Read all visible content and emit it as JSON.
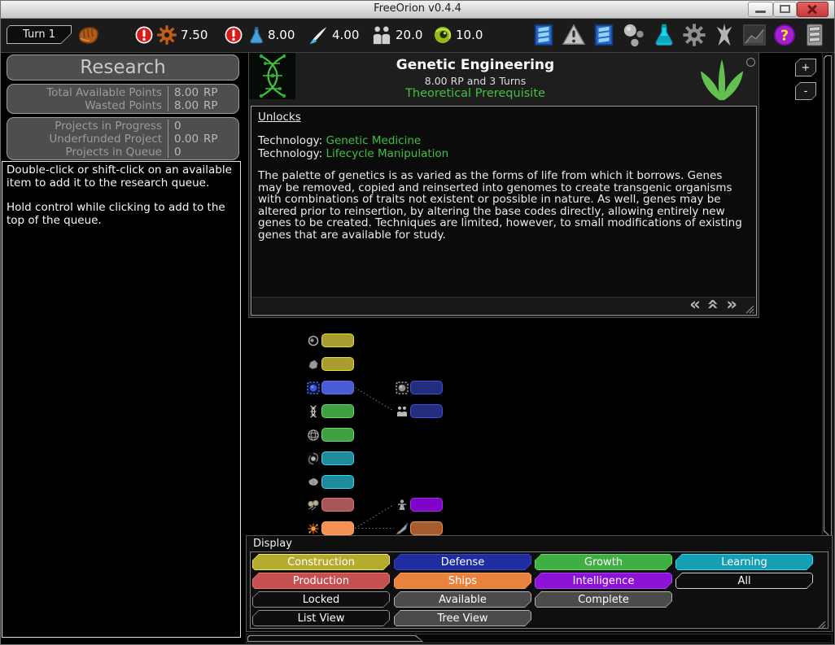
{
  "window": {
    "title": "FreeOrion v0.4.4"
  },
  "toolbar": {
    "turn_label": "Turn 1",
    "player_icon": "fist-icon",
    "resources": [
      {
        "name": "industry",
        "icon": "gearOrange",
        "alert": true,
        "value": "7.50"
      },
      {
        "name": "research",
        "icon": "flaskBlue",
        "alert": true,
        "value": "8.00"
      },
      {
        "name": "trade",
        "icon": "brush",
        "alert": false,
        "value": "4.00"
      },
      {
        "name": "population",
        "icon": "people",
        "alert": false,
        "value": "20.0"
      },
      {
        "name": "happiness",
        "icon": "eyeGreen",
        "alert": false,
        "value": "10.0"
      }
    ],
    "right_buttons": [
      {
        "name": "sitrep",
        "icon": "sitrep"
      },
      {
        "name": "alerts",
        "icon": "warning"
      },
      {
        "name": "queue",
        "icon": "sitrep"
      },
      {
        "name": "objects",
        "icon": "objects"
      },
      {
        "name": "research",
        "icon": "flaskCyan"
      },
      {
        "name": "production",
        "icon": "gearGray"
      },
      {
        "name": "design",
        "icon": "design"
      },
      {
        "name": "charts",
        "icon": "charts"
      },
      {
        "name": "pedia",
        "icon": "pedia"
      },
      {
        "name": "menu",
        "icon": "menu"
      }
    ]
  },
  "sidebar": {
    "title": "Research",
    "stats_points": [
      {
        "label": "Total Available Points",
        "value": "8.00",
        "unit": "RP"
      },
      {
        "label": "Wasted Points",
        "value": "8.00",
        "unit": "RP"
      }
    ],
    "stats_projects": [
      {
        "label": "Projects in Progress",
        "value": "0",
        "unit": ""
      },
      {
        "label": "Underfunded Project",
        "value": "0.00",
        "unit": "RP"
      },
      {
        "label": "Projects in Queue",
        "value": "0",
        "unit": ""
      }
    ],
    "help": [
      "Double-click or shift-click on an available item to add it to the research queue.",
      "Hold control while clicking to add to the top of the queue."
    ]
  },
  "detail": {
    "title": "Genetic Engineering",
    "cost": "8.00 RP and 3 Turns",
    "type": "Theoretical Prerequisite",
    "unlocks_heading": "Unlocks",
    "unlocks": [
      {
        "prefix": "Technology:",
        "name": "Genetic Medicine"
      },
      {
        "prefix": "Technology:",
        "name": "Lifecycle Manipulation"
      }
    ],
    "description": "The palette of genetics is as varied as the forms of life from which it borrows. Genes may be removed, copied and reinserted into genomes to create transgenic organisms with combinations of traits not existent or possible in nature. As well, genes may be altered prior to reinsertion, by altering the base codes directly, allowing entirely new genes to be created. Techniques are limited, however, to small modifications of existing genes that are available for study.",
    "nav": {
      "back": "«",
      "up": "«",
      "forward": "»"
    },
    "accent_green": "#3fc13f"
  },
  "zoom": {
    "in": "+",
    "out": "-"
  },
  "tree": {
    "nodes": [
      {
        "row": 0,
        "col": 0,
        "icon": "ring",
        "category": "construction",
        "fill": "#a79e2f",
        "border": "#e6df3e"
      },
      {
        "row": 1,
        "col": 0,
        "icon": "rock",
        "category": "construction",
        "fill": "#a79e2f",
        "border": "#e6df3e"
      },
      {
        "row": 2,
        "col": 0,
        "icon": "shieldBlue",
        "category": "defense",
        "fill": "#4a5cd6",
        "border": "#6170e8",
        "state": "selected"
      },
      {
        "row": 3,
        "col": 0,
        "icon": "dna",
        "category": "growth",
        "fill": "#3f9f43",
        "border": "#62df66"
      },
      {
        "row": 4,
        "col": 0,
        "icon": "globe",
        "category": "growth",
        "fill": "#3f9f43",
        "border": "#62df66"
      },
      {
        "row": 5,
        "col": 0,
        "icon": "galaxy",
        "category": "learning",
        "fill": "#1e8b9c",
        "border": "#3cd4e8"
      },
      {
        "row": 6,
        "col": 0,
        "icon": "brain",
        "category": "learning",
        "fill": "#1e8b9c",
        "border": "#3cd4e8"
      },
      {
        "row": 7,
        "col": 0,
        "icon": "bells",
        "category": "production",
        "fill": "#a75757",
        "border": "#da7272"
      },
      {
        "row": 8,
        "col": 0,
        "icon": "burst",
        "category": "ships",
        "fill": "#f69055",
        "border": "#f8a768"
      },
      {
        "row": 2,
        "col": 1,
        "icon": "shieldGray",
        "category": "defense",
        "fill": "#232e7e",
        "border": "#3b50da"
      },
      {
        "row": 3,
        "col": 1,
        "icon": "people16",
        "category": "defense",
        "fill": "#232e7e",
        "border": "#3b50da"
      },
      {
        "row": 7,
        "col": 1,
        "icon": "spy",
        "category": "intelligence",
        "fill": "#7f04c8",
        "border": "#a82af0"
      },
      {
        "row": 8,
        "col": 1,
        "icon": "rocket",
        "category": "ships",
        "fill": "#a65c2c",
        "border": "#ee8f48"
      }
    ],
    "edges": [
      {
        "from": 2,
        "to": 10
      },
      {
        "from": 8,
        "to": 11
      },
      {
        "from": 8,
        "to": 12
      }
    ]
  },
  "display": {
    "title": "Display",
    "rows": [
      [
        {
          "label": "Construction",
          "fill": "#b5ab2f",
          "border": "#f2ec4c"
        },
        {
          "label": "Defense",
          "fill": "#1f2da1",
          "border": "#3747c9"
        },
        {
          "label": "Growth",
          "fill": "#3fae43",
          "border": "#5cdc5c"
        },
        {
          "label": "Learning",
          "fill": "#169fb4",
          "border": "#33d9ec"
        }
      ],
      [
        {
          "label": "Production",
          "fill": "#c45050",
          "border": "#ee7474"
        },
        {
          "label": "Ships",
          "fill": "#e8823e",
          "border": "#f6a159"
        },
        {
          "label": "Intelligence",
          "fill": "#8c12d5",
          "border": "#b13af6"
        },
        {
          "label": "All",
          "fill": "#0e0e0e",
          "border": "#cfcfcf"
        }
      ],
      [
        {
          "label": "Locked",
          "fill": "#0e0e0e",
          "border": "#8f8f8f"
        },
        {
          "label": "Available",
          "fill": "#4b4b4b",
          "border": "#b2b2b2"
        },
        {
          "label": "Complete",
          "fill": "#4b4b4b",
          "border": "#b2b2b2"
        }
      ],
      [
        {
          "label": "List View",
          "fill": "#0e0e0e",
          "border": "#8f8f8f"
        },
        {
          "label": "Tree View",
          "fill": "#4b4b4b",
          "border": "#b2b2b2"
        }
      ]
    ]
  }
}
